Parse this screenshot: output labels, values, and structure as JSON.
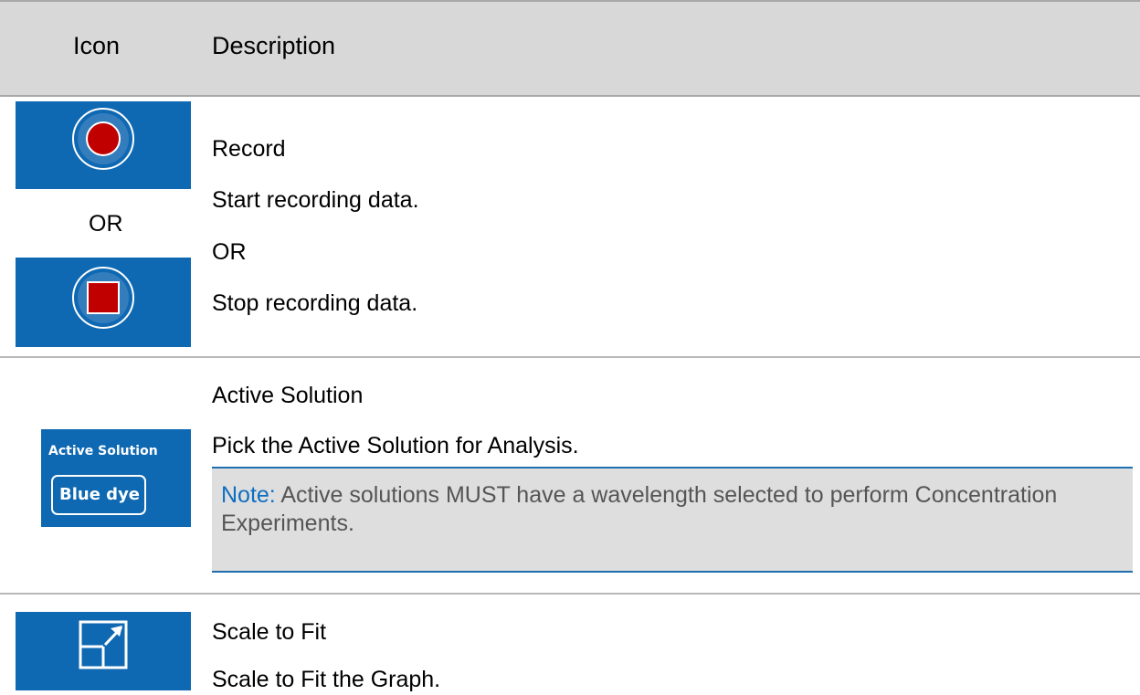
{
  "header": {
    "icon_col": "Icon",
    "desc_col": "Description"
  },
  "rows": [
    {
      "title": "Record",
      "lines": [
        "Start recording data.",
        "OR",
        "Stop recording data."
      ],
      "icon_separator": "OR",
      "icons": [
        "record-start-icon",
        "record-stop-icon"
      ]
    },
    {
      "title": "Active Solution",
      "lines": [
        "Pick the Active Solution for Analysis."
      ],
      "icon_title": "Active Solution",
      "icon_value": "Blue dye",
      "note_label": "Note:",
      "note_text": "Active solutions MUST have a wavelength selected to perform Concentration Experiments."
    },
    {
      "title": "Scale to Fit",
      "lines": [
        "Scale to Fit the Graph."
      ],
      "icons": [
        "scale-to-fit-icon"
      ]
    }
  ],
  "colors": {
    "header_bg": "#d8d8d8",
    "icon_bg": "#0e68b2",
    "record_red": "#c00000",
    "note_accent": "#0e6fc1"
  }
}
